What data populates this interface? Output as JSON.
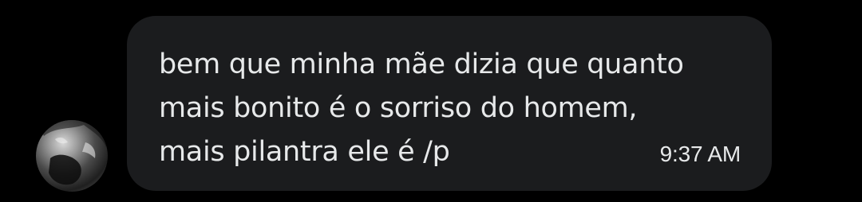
{
  "message": {
    "text": "bem que minha mãe dizia que quanto\nmais bonito é o sorriso do homem,\nmais pilantra ele é /p",
    "timestamp": "9:37 AM"
  },
  "sender": {
    "avatar_icon": "user-avatar-photo"
  },
  "colors": {
    "background": "#000000",
    "bubble": "#1b1c1e",
    "text": "#e7e9ea"
  }
}
